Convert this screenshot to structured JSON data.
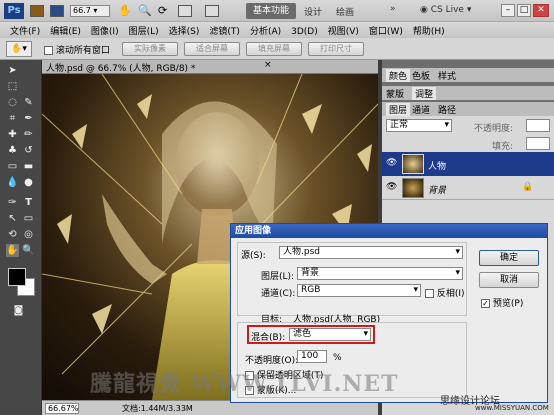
{
  "app": {
    "logo": "Ps",
    "workspace_btn": "基本功能",
    "ws_design": "设计",
    "ws_paint": "绘画",
    "ws_more": "»",
    "cs_live": "CS Live"
  },
  "menu": {
    "file": "文件(F)",
    "edit": "编辑(E)",
    "image": "图像(I)",
    "layer": "图层(L)",
    "select": "选择(S)",
    "filter": "滤镜(T)",
    "analysis": "分析(A)",
    "threeD": "3D(D)",
    "view": "视图(V)",
    "window": "窗口(W)",
    "help": "帮助(H)"
  },
  "options": {
    "scroll_all": "滚动所有窗口",
    "actual_pixels": "实际像素",
    "fit_screen": "适合屏幕",
    "fill_screen": "填充屏幕",
    "print_size": "打印尺寸"
  },
  "document": {
    "tab": "人物.psd @ 66.7% (人物, RGB/8) *",
    "zoom": "66.67%",
    "doc_info": "文档:1.44M/3.33M"
  },
  "panels": {
    "tabs_top": [
      "颜色",
      "色板",
      "样式"
    ],
    "tabs_mid": [
      "蒙版",
      "调整"
    ],
    "tabs_layers": [
      "图层",
      "通道",
      "路径"
    ],
    "blend_mode": "正常",
    "opacity_label": "不透明度:",
    "fill_label": "填充:",
    "layers": [
      {
        "name": "人物"
      },
      {
        "name": "背景"
      }
    ]
  },
  "dialog": {
    "title": "应用图像",
    "source_label": "源(S):",
    "source_value": "人物.psd",
    "layer_label": "图层(L):",
    "layer_value": "背景",
    "channel_label": "通道(C):",
    "channel_value": "RGB",
    "invert_label": "反相(I)",
    "target_label": "目标:",
    "target_value": "人物.psd(人物, RGB)",
    "blending_label": "混合(B):",
    "blending_value": "滤色",
    "opacity_label": "不透明度(O):",
    "opacity_value": "100",
    "opacity_unit": "%",
    "preserve_label": "保留透明区域(T)",
    "mask_label": "蒙版(K)...",
    "ok": "确定",
    "cancel": "取消",
    "preview": "预览(P)"
  },
  "watermark": {
    "text": "騰龍視覺 WWW.TLVI.NET",
    "site": "思缘设计论坛",
    "url": "www.MISSYUAN.COM"
  }
}
